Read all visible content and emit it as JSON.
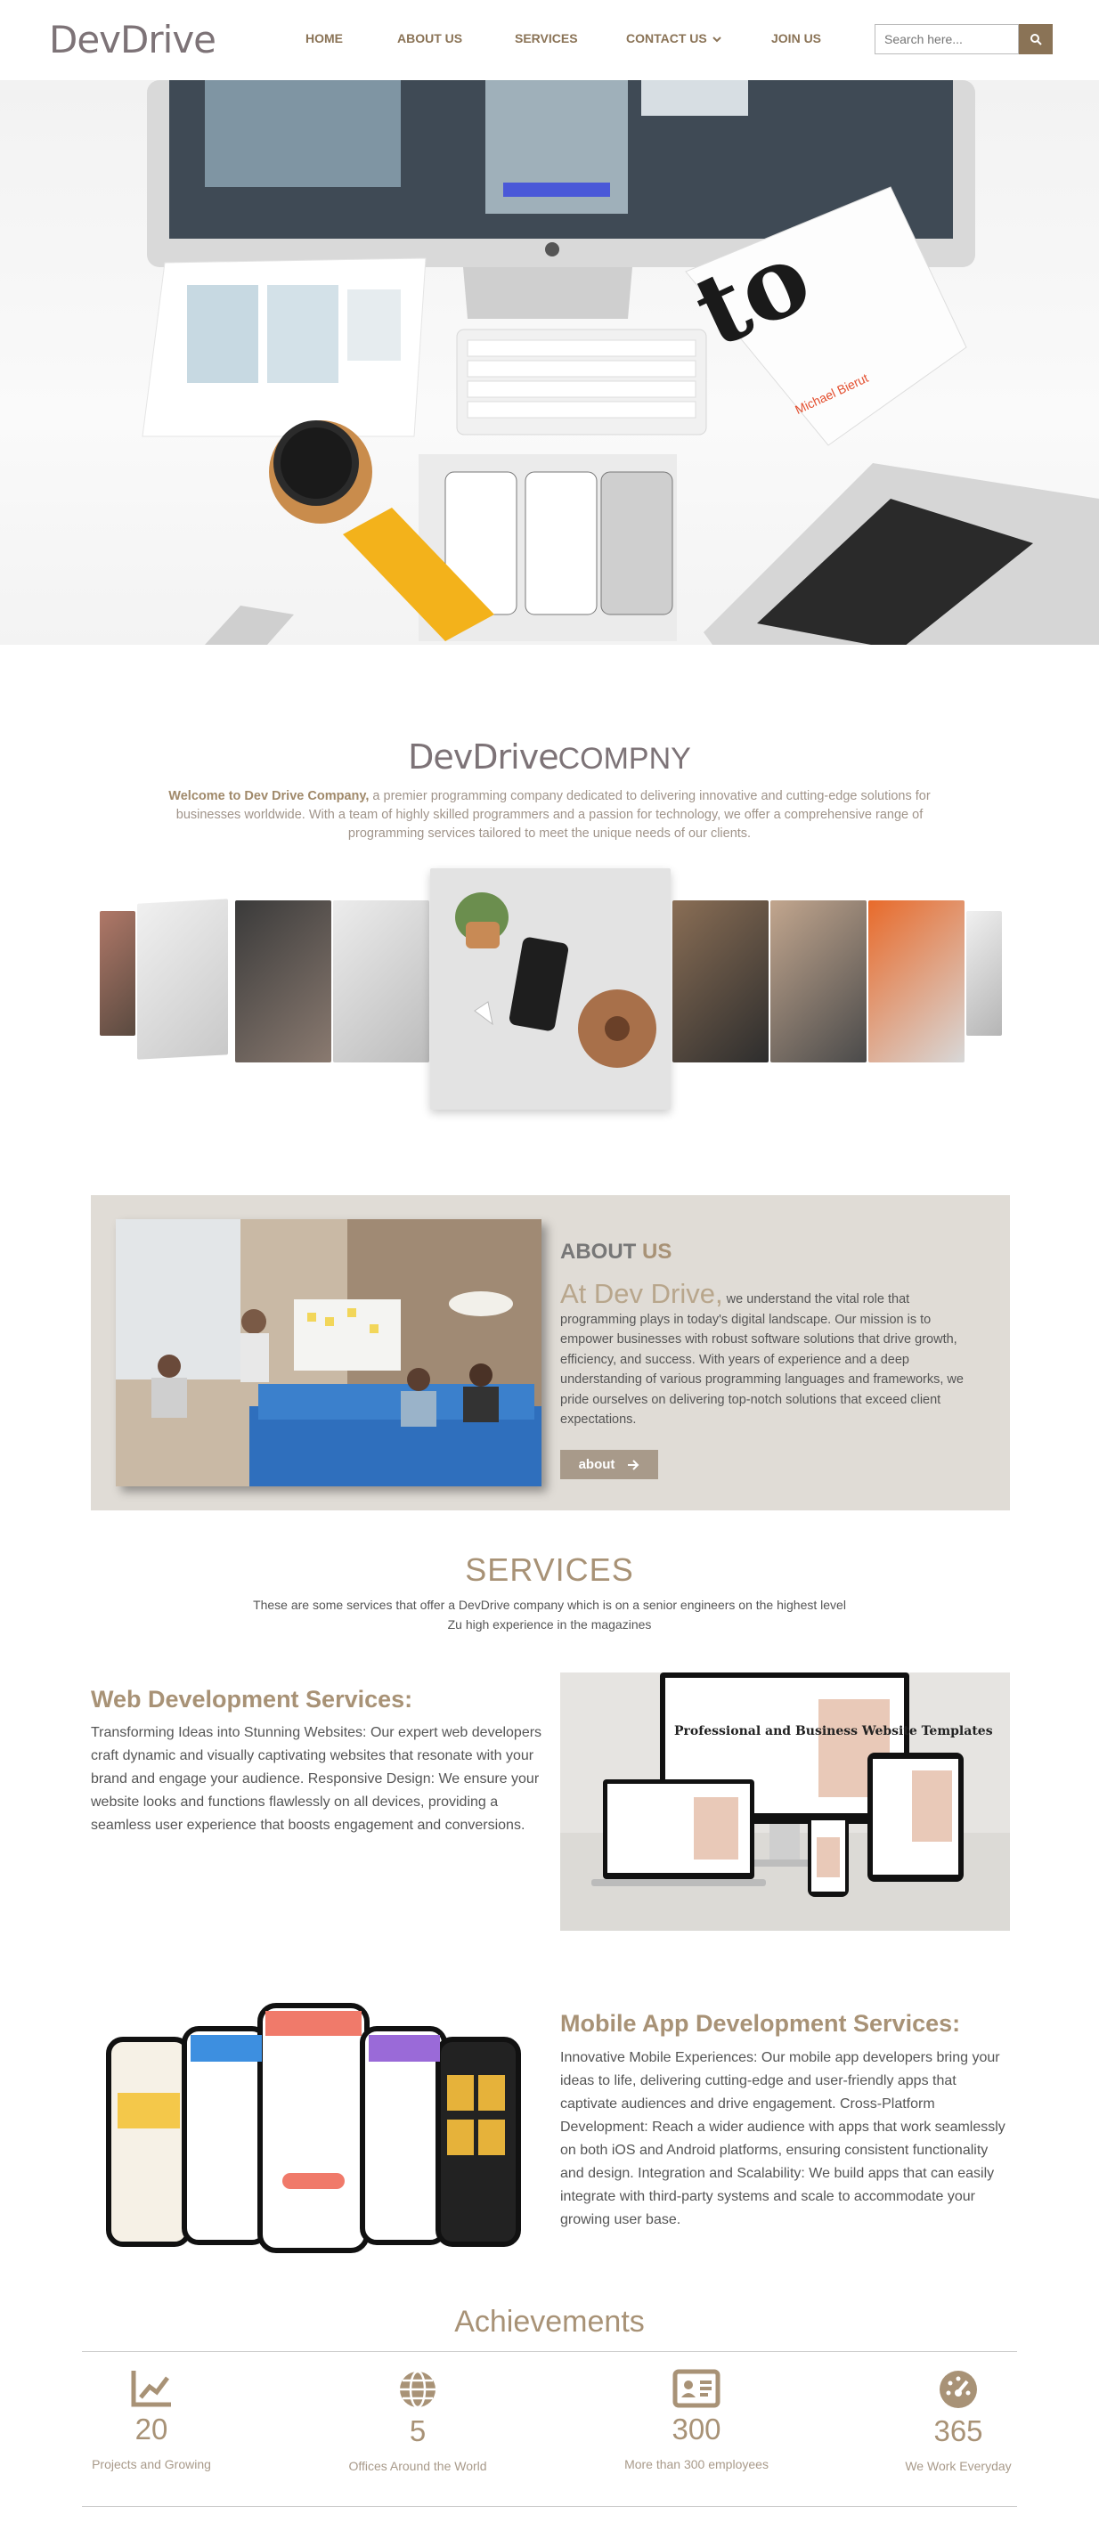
{
  "header": {
    "logo": "DevDrive",
    "nav": [
      "HOME",
      "ABOUT US",
      "SERVICES",
      "CONTACT US",
      "JOIN US"
    ],
    "search_placeholder": "Search here..."
  },
  "company": {
    "logo_main": "DevDrive",
    "logo_suffix": "COMPNY",
    "intro_bold": "Welcome to Dev Drive Company,",
    "intro_rest": " a premier programming company dedicated to delivering innovative and cutting-edge solutions for businesses worldwide. With a team of highly skilled programmers and a passion for technology, we offer a comprehensive range of programming services tailored to meet the unique needs of our clients."
  },
  "about": {
    "title_a": "ABOUT ",
    "title_b": "US",
    "lead_big": "At Dev Drive,",
    "lead_rest": " we understand the vital role that programming plays in today's digital landscape. Our mission is to empower businesses with robust software solutions that drive growth, efficiency, and success. With years of experience and a deep understanding of various programming languages and frameworks, we pride ourselves on delivering top-notch solutions that exceed client expectations.",
    "button": "about"
  },
  "services": {
    "title": "SERVICES",
    "desc": "These are some services that offer a DevDrive company which is on a senior engineers on the highest level Zu high experience in the magazines",
    "web_title": "Web Development Services:",
    "web_text": "Transforming Ideas into Stunning Websites: Our expert web developers craft dynamic and visually captivating websites that resonate with your brand and engage your audience. Responsive Design: We ensure your website looks and functions flawlessly on all devices, providing a seamless user experience that boosts engagement and conversions.",
    "web_mock_headline": "Professional and Business Website Templates",
    "mobile_title": "Mobile App Development Services:",
    "mobile_text": "Innovative Mobile Experiences: Our mobile app developers bring your ideas to life, delivering cutting-edge and user-friendly apps that captivate audiences and drive engagement. Cross-Platform Development: Reach a wider audience with apps that work seamlessly on both iOS and Android platforms, ensuring consistent functionality and design. Integration and Scalability: We build apps that can easily integrate with third-party systems and scale to accommodate your growing user base."
  },
  "achievements": {
    "title": "Achievements",
    "items": [
      {
        "icon": "chart-line-icon",
        "num": "20",
        "label": "Projects and Growing"
      },
      {
        "icon": "globe-icon",
        "num": "5",
        "label": "Offices Around the World"
      },
      {
        "icon": "id-card-icon",
        "num": "300",
        "label": "More than 300 employees"
      },
      {
        "icon": "gauge-icon",
        "num": "365",
        "label": "We Work Everyday"
      }
    ]
  },
  "colors": {
    "accent": "#8a7356",
    "accent_light": "#a89276",
    "about_bg": "#e0dcd6"
  }
}
